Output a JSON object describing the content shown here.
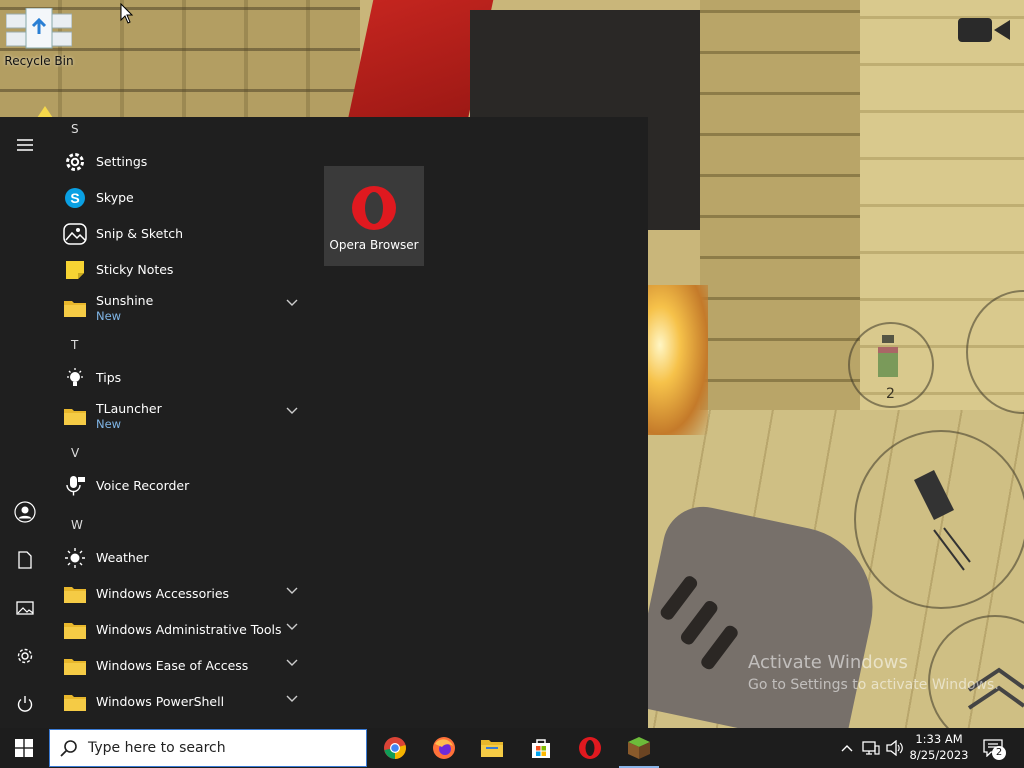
{
  "desktop": {
    "recycle_bin_label": "Recycle Bin",
    "game_grenade_count": "2",
    "watermark_title": "Activate Windows",
    "watermark_sub": "Go to Settings to activate Windows."
  },
  "start_menu": {
    "headers": {
      "s": "S",
      "t": "T",
      "v": "V",
      "w": "W"
    },
    "apps": {
      "settings": "Settings",
      "skype": "Skype",
      "snip": "Snip & Sketch",
      "sticky": "Sticky Notes",
      "sunshine": "Sunshine",
      "tips": "Tips",
      "tlauncher": "TLauncher",
      "voice": "Voice Recorder",
      "weather": "Weather",
      "win_accessories": "Windows Accessories",
      "win_admin": "Windows Administrative Tools",
      "win_ease": "Windows Ease of Access",
      "win_ps": "Windows PowerShell"
    },
    "new_badge": "New",
    "pinned_tile": "Opera Browser"
  },
  "taskbar": {
    "search_placeholder": "Type here to search",
    "time": "1:33 AM",
    "date": "8/25/2023",
    "notification_count": "2"
  },
  "colors": {
    "start_bg": "#1f1f1f",
    "taskbar_bg": "#1d1d1d",
    "new_badge": "#7fb5e6",
    "opera_red": "#e0191f"
  }
}
